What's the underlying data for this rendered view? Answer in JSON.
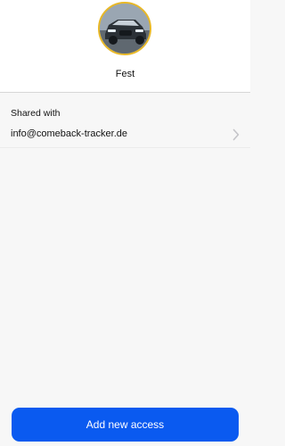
{
  "vehicle": {
    "name": "Fest"
  },
  "shared": {
    "section_label": "Shared with",
    "items": [
      {
        "email": "info@comeback-tracker.de"
      }
    ]
  },
  "actions": {
    "add_access_label": "Add new access"
  },
  "colors": {
    "accent": "#0a5af0",
    "avatar_ring": "#e8b828",
    "background": "#f7f7f7"
  },
  "icons": {
    "row_chevron": "chevron-right-icon"
  }
}
